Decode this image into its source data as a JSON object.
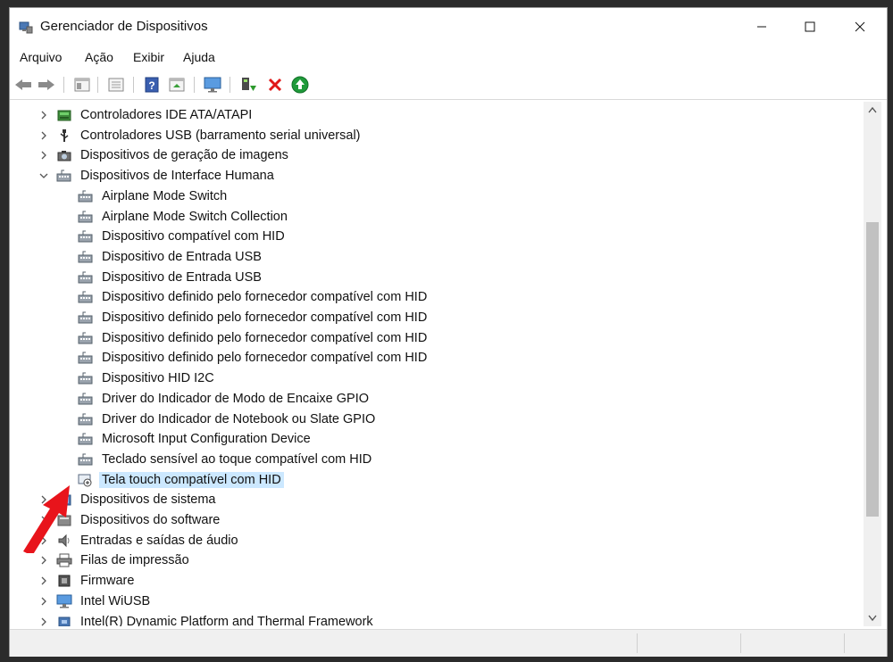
{
  "window": {
    "title": "Gerenciador de Dispositivos"
  },
  "menu": [
    "Arquivo",
    "Ação",
    "Exibir",
    "Ajuda"
  ],
  "toolbar": [
    "back-icon",
    "forward-icon",
    "properties-view-icon",
    "list-view-icon",
    "help-icon",
    "action-view-icon",
    "monitor-icon",
    "update-driver-icon",
    "uninstall-icon",
    "scan-hardware-icon"
  ],
  "tree": [
    {
      "label": "Controladores IDE ATA/ATAPI",
      "level": 0,
      "expander": "collapsed",
      "icon": "ide-controller-icon"
    },
    {
      "label": "Controladores USB (barramento serial universal)",
      "level": 0,
      "expander": "collapsed",
      "icon": "usb-icon"
    },
    {
      "label": "Dispositivos de geração de imagens",
      "level": 0,
      "expander": "collapsed",
      "icon": "camera-icon"
    },
    {
      "label": "Dispositivos de Interface Humana",
      "level": 0,
      "expander": "expanded",
      "icon": "hid-icon"
    },
    {
      "label": "Airplane Mode Switch",
      "level": 1,
      "icon": "hid-icon"
    },
    {
      "label": "Airplane Mode Switch Collection",
      "level": 1,
      "icon": "hid-icon"
    },
    {
      "label": "Dispositivo compatível com HID",
      "level": 1,
      "icon": "hid-icon"
    },
    {
      "label": "Dispositivo de Entrada USB",
      "level": 1,
      "icon": "hid-icon"
    },
    {
      "label": "Dispositivo de Entrada USB",
      "level": 1,
      "icon": "hid-icon"
    },
    {
      "label": "Dispositivo definido pelo fornecedor compatível com HID",
      "level": 1,
      "icon": "hid-icon"
    },
    {
      "label": "Dispositivo definido pelo fornecedor compatível com HID",
      "level": 1,
      "icon": "hid-icon"
    },
    {
      "label": "Dispositivo definido pelo fornecedor compatível com HID",
      "level": 1,
      "icon": "hid-icon"
    },
    {
      "label": "Dispositivo definido pelo fornecedor compatível com HID",
      "level": 1,
      "icon": "hid-icon"
    },
    {
      "label": "Dispositivo HID I2C",
      "level": 1,
      "icon": "hid-icon"
    },
    {
      "label": "Driver do Indicador de Modo de Encaixe GPIO",
      "level": 1,
      "icon": "hid-icon"
    },
    {
      "label": "Driver do Indicador de Notebook ou Slate GPIO",
      "level": 1,
      "icon": "hid-icon"
    },
    {
      "label": "Microsoft Input Configuration Device",
      "level": 1,
      "icon": "hid-icon"
    },
    {
      "label": "Teclado sensível ao toque compatível com HID",
      "level": 1,
      "icon": "hid-icon"
    },
    {
      "label": "Tela touch compatível com HID",
      "level": 1,
      "icon": "touch-screen-icon",
      "selected": true
    },
    {
      "label": "Dispositivos de sistema",
      "level": 0,
      "expander": "collapsed",
      "icon": "system-device-icon"
    },
    {
      "label": "Dispositivos do software",
      "level": 0,
      "expander": "collapsed",
      "icon": "software-device-icon"
    },
    {
      "label": "Entradas e saídas de áudio",
      "level": 0,
      "expander": "collapsed",
      "icon": "speaker-icon"
    },
    {
      "label": "Filas de impressão",
      "level": 0,
      "expander": "collapsed",
      "icon": "printer-icon"
    },
    {
      "label": "Firmware",
      "level": 0,
      "expander": "collapsed",
      "icon": "firmware-icon"
    },
    {
      "label": "Intel WiUSB",
      "level": 0,
      "expander": "collapsed",
      "icon": "monitor-icon"
    },
    {
      "label": "Intel(R) Dynamic Platform and Thermal Framework",
      "level": 0,
      "expander": "collapsed",
      "icon": "chip-icon"
    }
  ],
  "colors": {
    "selection": "#cce8ff",
    "annotation_arrow": "#e8141b"
  }
}
